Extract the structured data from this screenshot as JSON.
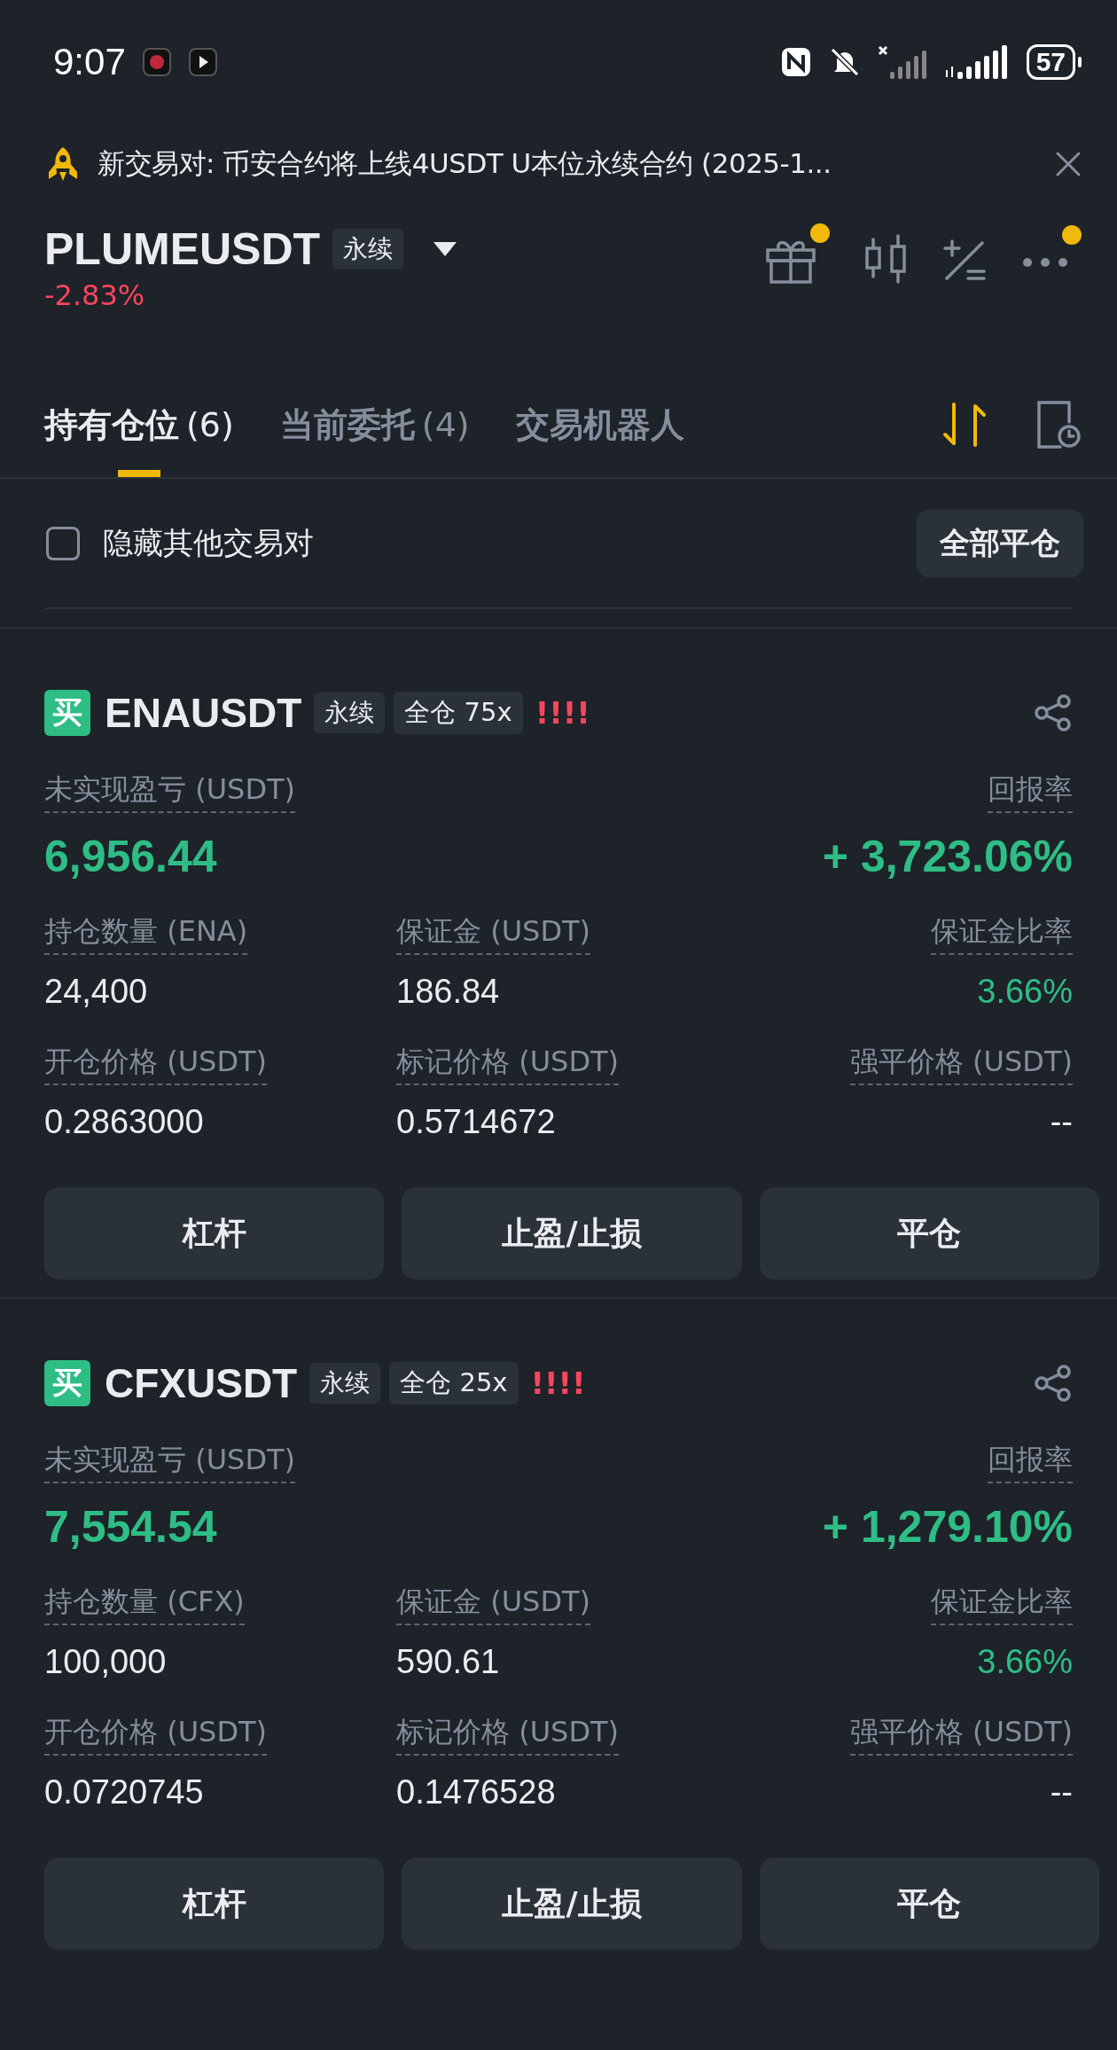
{
  "status_bar": {
    "time": "9:07",
    "battery": "57"
  },
  "banner": {
    "text": "新交易对: 币安合约将上线4USDT U本位永续合约 (2025-1..."
  },
  "header": {
    "symbol": "PLUMEUSDT",
    "tag": "永续",
    "change": "-2.83%",
    "gift_dot": true,
    "more_dot": true
  },
  "tabs": [
    {
      "label": "持有仓位",
      "count": "(6)",
      "selected": true
    },
    {
      "label": "当前委托",
      "count": "(4)",
      "selected": false
    },
    {
      "label": "交易机器人",
      "selected": false
    }
  ],
  "filter": {
    "label": "隐藏其他交易对",
    "checked": false,
    "close_all": "全部平仓"
  },
  "positions": [
    {
      "side": "买",
      "symbol": "ENAUSDT",
      "type": "永续",
      "margin_mode": "全仓 75x",
      "risk": "!!!!",
      "pnl_label": "未实现盈亏 (USDT)",
      "pnl": "6,956.44",
      "roe_label": "回报率",
      "roe": "+ 3,723.06%",
      "fields": [
        {
          "label": "持仓数量 (ENA)",
          "value": "24,400",
          "positive": false
        },
        {
          "label": "保证金 (USDT)",
          "value": "186.84",
          "positive": false
        },
        {
          "label": "保证金比率",
          "value": "3.66%",
          "positive": true
        },
        {
          "label": "开仓价格 (USDT)",
          "value": "0.2863000",
          "positive": false
        },
        {
          "label": "标记价格 (USDT)",
          "value": "0.5714672",
          "positive": false
        },
        {
          "label": "强平价格 (USDT)",
          "value": "--",
          "positive": false
        }
      ],
      "buttons": [
        "杠杆",
        "止盈/止损",
        "平仓"
      ]
    },
    {
      "side": "买",
      "symbol": "CFXUSDT",
      "type": "永续",
      "margin_mode": "全仓 25x",
      "risk": "!!!!",
      "pnl_label": "未实现盈亏 (USDT)",
      "pnl": "7,554.54",
      "roe_label": "回报率",
      "roe": "+ 1,279.10%",
      "fields": [
        {
          "label": "持仓数量 (CFX)",
          "value": "100,000",
          "positive": false
        },
        {
          "label": "保证金 (USDT)",
          "value": "590.61",
          "positive": false
        },
        {
          "label": "保证金比率",
          "value": "3.66%",
          "positive": true
        },
        {
          "label": "开仓价格 (USDT)",
          "value": "0.0720745",
          "positive": false
        },
        {
          "label": "标记价格 (USDT)",
          "value": "0.1476528",
          "positive": false
        },
        {
          "label": "强平价格 (USDT)",
          "value": "--",
          "positive": false
        }
      ],
      "buttons": [
        "杠杆",
        "止盈/止损",
        "平仓"
      ]
    }
  ]
}
